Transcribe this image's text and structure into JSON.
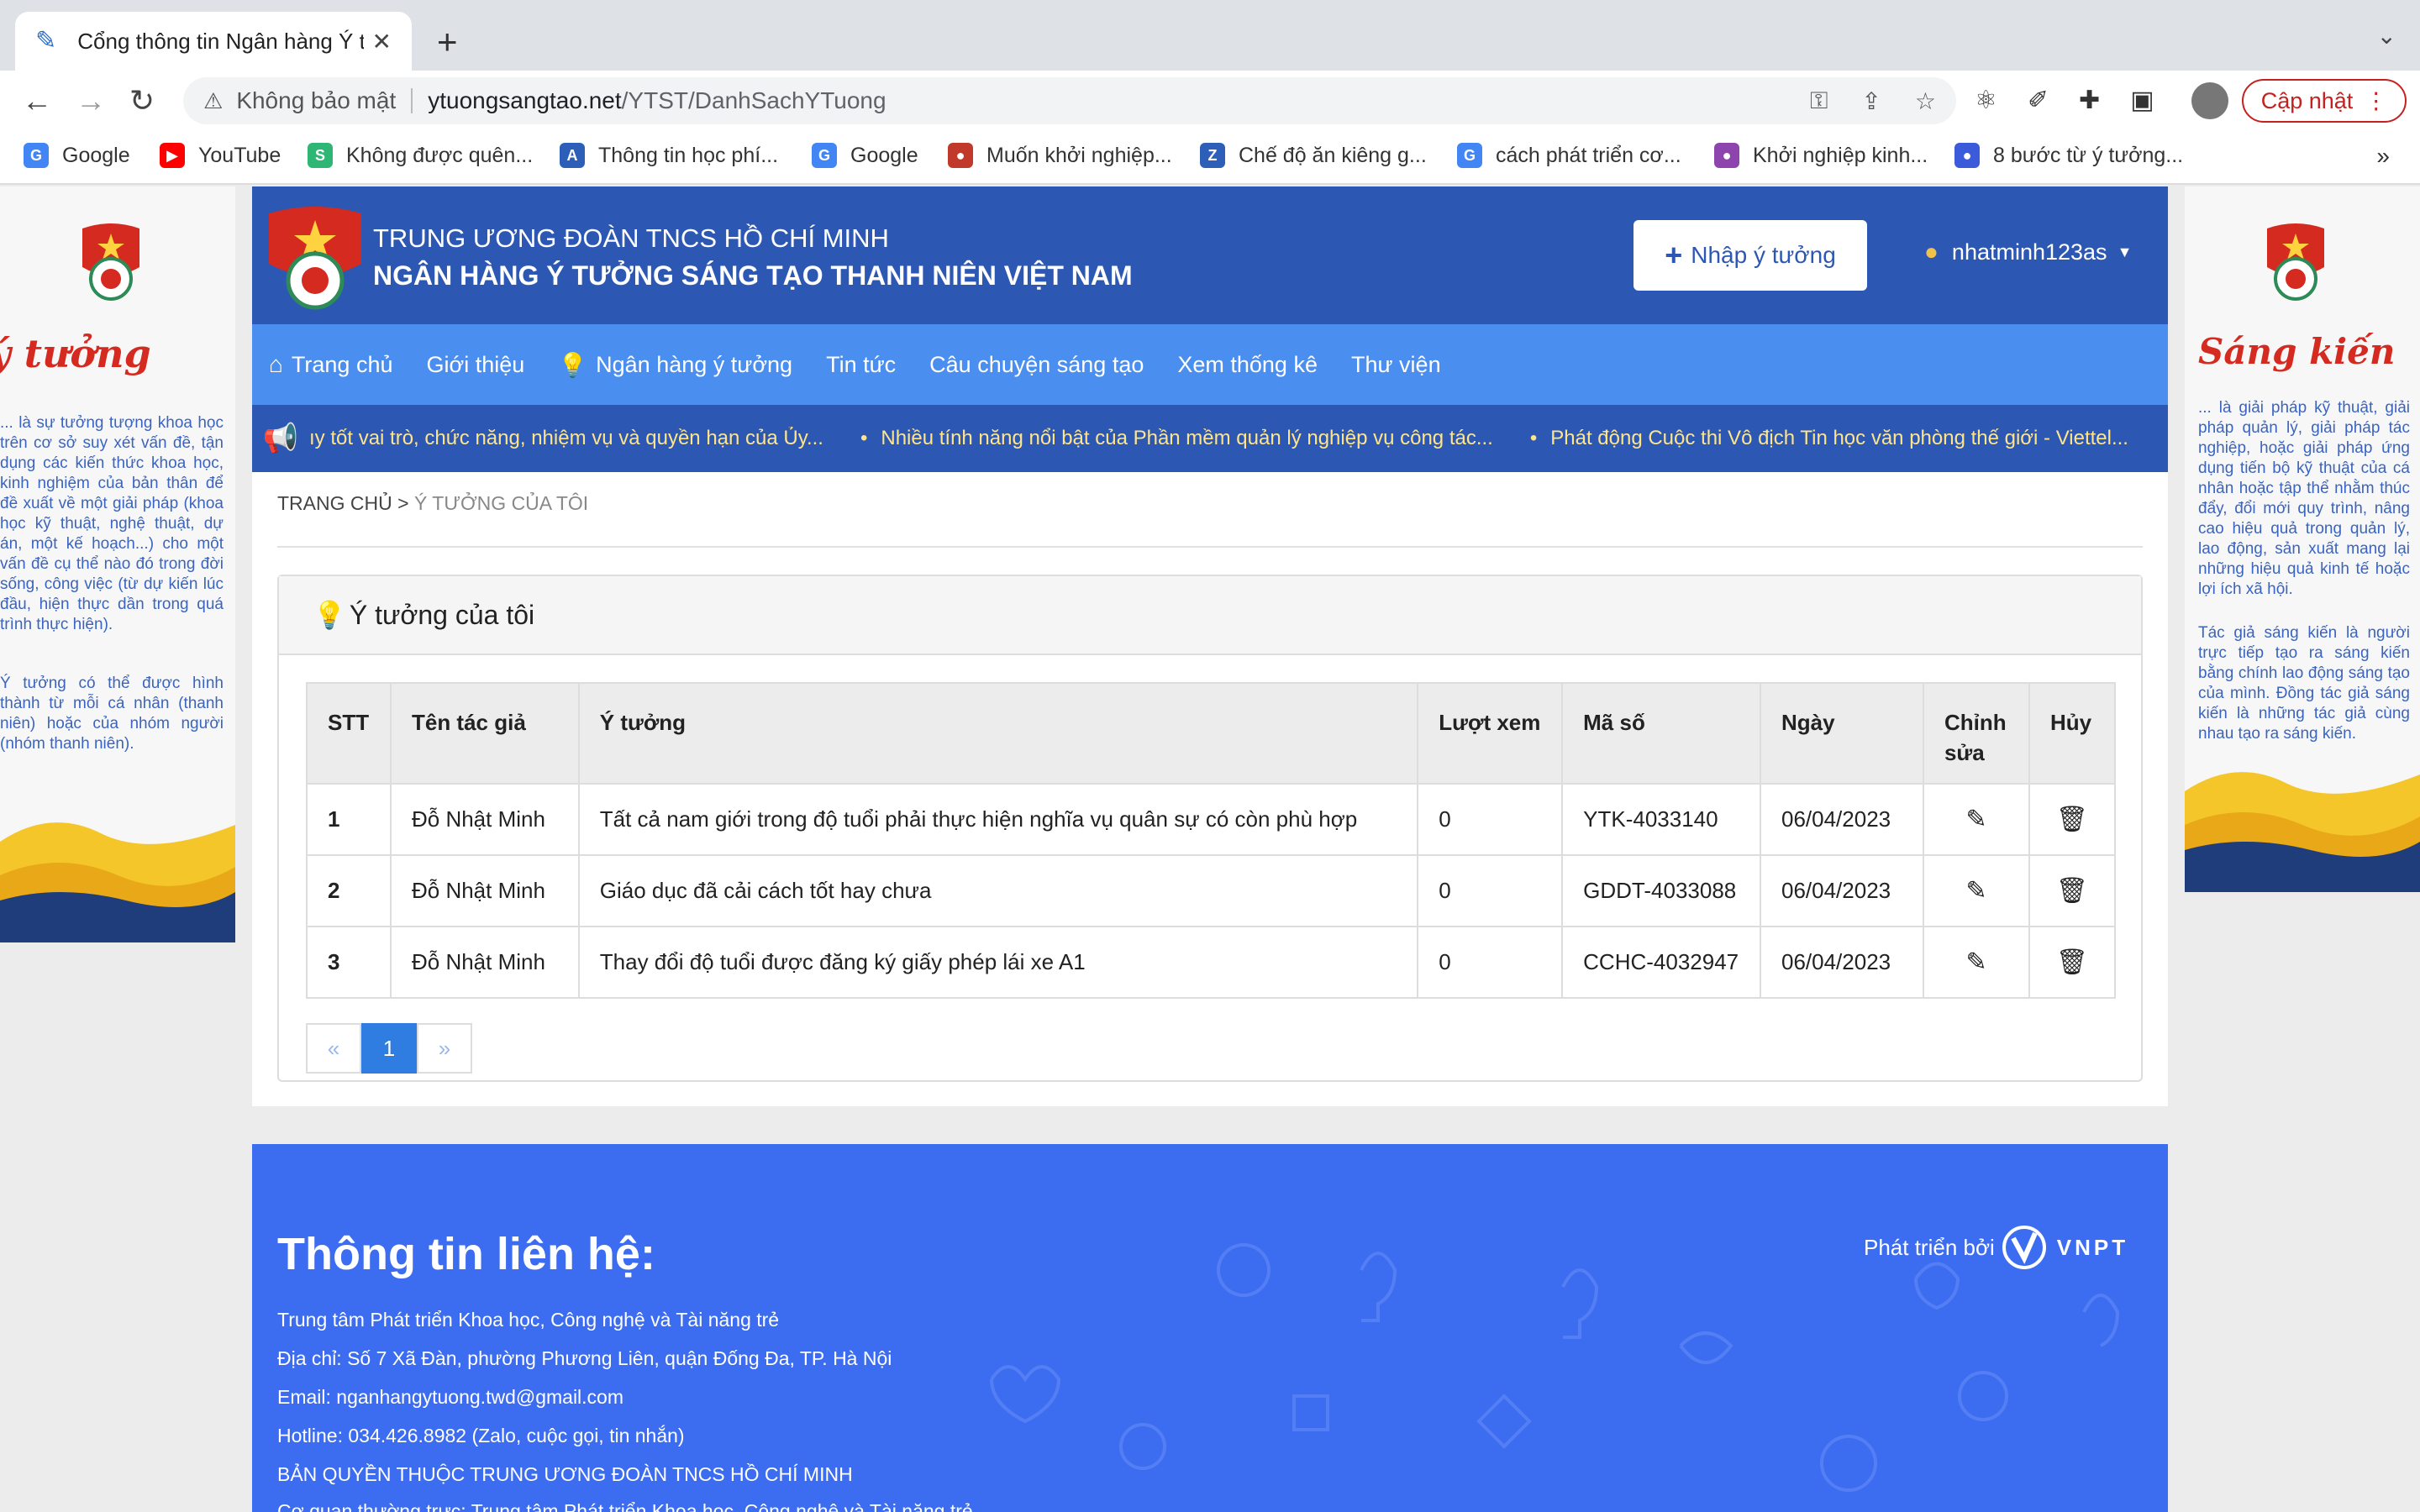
{
  "browser": {
    "tab_title": "Cổng thông tin Ngân hàng Ý tưởng",
    "new_tab": "+",
    "security": "Không bảo mật",
    "url_host": "ytuongsangtao.net",
    "url_path": "/YTST/DanhSachYTuong",
    "update_label": "Cập nhật",
    "bookmarks": [
      {
        "label": "Google",
        "color": "#4285f4",
        "glyph": "G"
      },
      {
        "label": "YouTube",
        "color": "#ff0000",
        "glyph": "▶"
      },
      {
        "label": "Không được quên...",
        "color": "#2db674",
        "glyph": "S"
      },
      {
        "label": "Thông tin học phí...",
        "color": "#2d5fb8",
        "glyph": "A"
      },
      {
        "label": "Google",
        "color": "#4285f4",
        "glyph": "G"
      },
      {
        "label": "Muốn khởi nghiệp...",
        "color": "#c0392b",
        "glyph": "●"
      },
      {
        "label": "Chế độ ăn kiêng g...",
        "color": "#2d5fb8",
        "glyph": "Z"
      },
      {
        "label": "cách phát triển cơ...",
        "color": "#4285f4",
        "glyph": "G"
      },
      {
        "label": "Khởi nghiệp kinh...",
        "color": "#8e44ad",
        "glyph": "●"
      },
      {
        "label": "8 bước từ ý tưởng...",
        "color": "#3b5bdb",
        "glyph": "●"
      }
    ],
    "bookmarks_more": "»"
  },
  "side_left": {
    "heading": "ý tưởng",
    "para1": "... là sự tưởng tượng khoa học trên cơ sở suy xét vấn đề, tận dụng các kiến thức khoa học, kinh nghiệm của bản thân để đề xuất về một giải pháp (khoa học kỹ thuật, nghệ thuật, dự án, một kế hoạch...) cho một vấn đề cụ thể nào đó trong đời sống, công việc (từ dự kiến lúc đầu, hiện thực dần trong quá trình thực hiện).",
    "para2": "Ý tưởng có thể được hình thành từ mỗi cá nhân (thanh niên) hoặc của nhóm người (nhóm thanh niên)."
  },
  "side_right": {
    "heading": "Sáng kiến",
    "para1": "... là giải pháp kỹ thuật, giải pháp quản lý, giải pháp tác nghiệp, hoặc giải pháp ứng dụng tiến bộ kỹ thuật của cá nhân hoặc tập thể nhằm thúc đẩy, đổi mới quy trình, nâng cao hiệu quả trong quản lý, lao động, sản xuất mang lại những hiệu quả kinh tế hoặc lợi ích xã hội.",
    "para2": "Tác giả sáng kiến là người trực tiếp tạo ra sáng kiến bằng chính lao động sáng tạo của mình. Đồng tác giả sáng kiến là những tác giả cùng nhau tạo ra sáng kiến."
  },
  "header": {
    "org_line1": "TRUNG ƯƠNG ĐOÀN TNCS HỒ CHÍ MINH",
    "org_line2": "NGÂN HÀNG Ý TƯỞNG SÁNG TẠO THANH NIÊN VIỆT NAM",
    "submit_label": "Nhập ý tưởng",
    "username": "nhatminh123as"
  },
  "menu": [
    {
      "label": "Trang chủ",
      "icon": "home-icon"
    },
    {
      "label": "Giới thiệu",
      "icon": ""
    },
    {
      "label": "Ngân hàng ý tưởng",
      "icon": "lightbulb-icon"
    },
    {
      "label": "Tin tức",
      "icon": ""
    },
    {
      "label": "Câu chuyện sáng tạo",
      "icon": ""
    },
    {
      "label": "Xem thống kê",
      "icon": ""
    },
    {
      "label": "Thư viện",
      "icon": ""
    }
  ],
  "ticker": [
    "ıy tốt vai trò, chức năng, nhiệm vụ và quyền hạn của Ủy...",
    "Nhiều tính năng nổi bật của Phần mềm quản lý nghiệp vụ công tác...",
    "Phát động Cuộc thi Vô địch Tin học văn phòng thế giới - Viettel..."
  ],
  "breadcrumb": {
    "home": "TRANG CHỦ",
    "sep": ">",
    "current": "Ý TƯỞNG CỦA TÔI"
  },
  "panel": {
    "title": "Ý tưởng của tôi"
  },
  "table": {
    "headers": [
      "STT",
      "Tên tác giả",
      "Ý tưởng",
      "Lượt xem",
      "Mã số",
      "Ngày",
      "Chỉnh sửa",
      "Hủy"
    ],
    "rows": [
      [
        "1",
        "Đỗ Nhật Minh",
        "Tất cả nam giới trong độ tuổi phải thực hiện nghĩa vụ quân sự có còn phù hợp",
        "0",
        "YTK-4033140",
        "06/04/2023"
      ],
      [
        "2",
        "Đỗ Nhật Minh",
        "Giáo dục đã cải cách tốt hay chưa",
        "0",
        "GDDT-4033088",
        "06/04/2023"
      ],
      [
        "3",
        "Đỗ Nhật Minh",
        "Thay đổi độ tuổi được đăng ký giấy phép lái xe A1",
        "0",
        "CCHC-4032947",
        "06/04/2023"
      ]
    ]
  },
  "pager": {
    "prev": "«",
    "current": "1",
    "next": "»"
  },
  "footer": {
    "title": "Thông tin liên hệ:",
    "lines": [
      "Trung tâm Phát triển Khoa học, Công nghệ và Tài năng trẻ",
      "Địa chỉ: Số 7 Xã Đàn, phường Phương Liên, quận Đống Đa, TP. Hà Nội",
      "Email: nganhangytuong.twd@gmail.com",
      "Hotline: 034.426.8982 (Zalo, cuộc gọi, tin nhắn)",
      "BẢN QUYỀN THUỘC TRUNG ƯƠNG ĐOÀN TNCS HỒ CHÍ MINH",
      "Cơ quan thường trực: Trung tâm Phát triển Khoa học, Công nghệ và Tài năng trẻ"
    ],
    "dev_label": "Phát triển bởi",
    "dev_brand": "VNPT"
  },
  "colors": {
    "header_bg": "#2c58b3",
    "menu_bg": "#4a8ef0",
    "footer_bg": "#3c6cf0",
    "ticker_text": "#ffe48a",
    "accent_red": "#d42a1f"
  }
}
